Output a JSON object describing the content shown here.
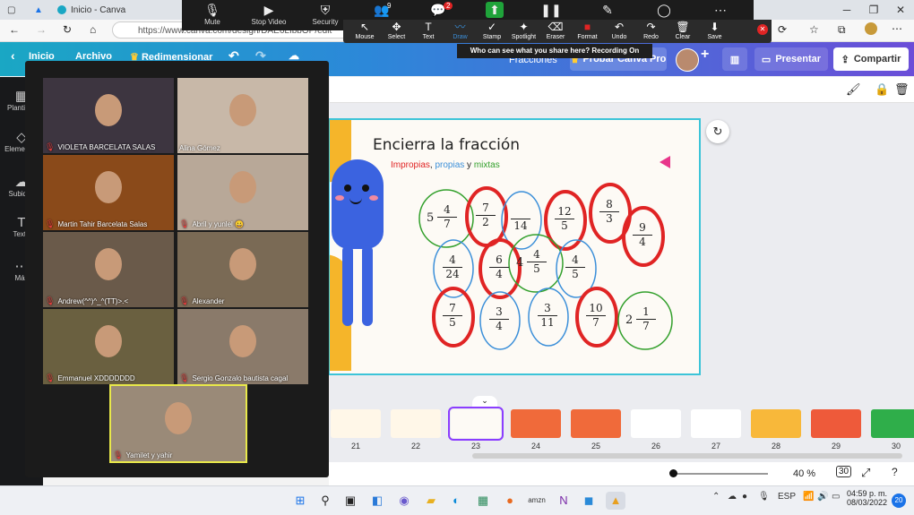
{
  "browser": {
    "tab_title": "Inicio - Canva",
    "address": "https://www.canva.com/design/DAE6LIbbOP/edit",
    "window_controls": [
      "─",
      "❐",
      "✕"
    ]
  },
  "zoom_toolbar": {
    "buttons": [
      {
        "label": "Mute",
        "icon": "mic-icon"
      },
      {
        "label": "Stop Video",
        "icon": "video-icon"
      },
      {
        "label": "Security",
        "icon": "shield-icon"
      },
      {
        "label": "",
        "icon": "participants-icon",
        "badge": "9"
      },
      {
        "label": "",
        "icon": "chat-icon",
        "badge": "2"
      },
      {
        "label": "",
        "icon": "share-icon"
      },
      {
        "label": "",
        "icon": "pause-icon"
      },
      {
        "label": "",
        "icon": "annotate-icon"
      },
      {
        "label": "",
        "icon": "remote-icon"
      },
      {
        "label": "",
        "icon": "more-icon"
      }
    ],
    "annotate": [
      "Mouse",
      "Select",
      "Text",
      "Draw",
      "Stamp",
      "Spotlight",
      "Eraser",
      "Format",
      "Undo",
      "Redo",
      "Clear",
      "Save"
    ],
    "recording_text": "Who can see what you share here? Recording On"
  },
  "canva": {
    "nav": [
      "Inicio",
      "Archivo",
      "Redimensionar"
    ],
    "design_title": "Fracciones",
    "try_pro": "Probar Canva Pro",
    "present": "Presentar",
    "share": "Compartir",
    "side": [
      "Plantillas",
      "Elementos",
      "Subidos",
      "Texto",
      "Más"
    ],
    "zoom_level": "40 %",
    "page_count": "30"
  },
  "slide": {
    "title": "Encierra la fracción",
    "subtitle_parts": [
      "Impropias",
      ", ",
      "propias",
      " y ",
      "mixtas"
    ],
    "colors": {
      "improper": "#e02424",
      "proper": "#3b8fd9",
      "mixed": "#33a02c"
    },
    "fractions": [
      {
        "whole": "5",
        "n": "4",
        "d": "7",
        "circle": "green"
      },
      {
        "whole": "",
        "n": "7",
        "d": "2",
        "circle": "red"
      },
      {
        "whole": "",
        "n": "",
        "d": "14",
        "circle": "blue"
      },
      {
        "whole": "",
        "n": "12",
        "d": "5",
        "circle": "red"
      },
      {
        "whole": "",
        "n": "8",
        "d": "3",
        "circle": "red"
      },
      {
        "whole": "",
        "n": "9",
        "d": "4",
        "circle": "red"
      },
      {
        "whole": "",
        "n": "4",
        "d": "24",
        "circle": "blue"
      },
      {
        "whole": "",
        "n": "6",
        "d": "4",
        "circle": "red"
      },
      {
        "whole": "4",
        "n": "4",
        "d": "5",
        "circle": "green"
      },
      {
        "whole": "",
        "n": "4",
        "d": "5",
        "circle": "blue"
      },
      {
        "whole": "",
        "n": "7",
        "d": "5",
        "circle": "red"
      },
      {
        "whole": "",
        "n": "3",
        "d": "4",
        "circle": "blue"
      },
      {
        "whole": "",
        "n": "3",
        "d": "11",
        "circle": "blue"
      },
      {
        "whole": "",
        "n": "10",
        "d": "7",
        "circle": "red"
      },
      {
        "whole": "2",
        "n": "1",
        "d": "7",
        "circle": "green"
      }
    ]
  },
  "filmstrip": {
    "pages": [
      "21",
      "22",
      "23",
      "24",
      "25",
      "26",
      "27",
      "28",
      "29",
      "30"
    ],
    "thumb_colors": [
      "#fff7e8",
      "#fff7e8",
      "#fdfaf5",
      "#f06a3a",
      "#f06a3a",
      "#fff",
      "#fff",
      "#f8b83a",
      "#ee5a3a",
      "#2fae4a"
    ],
    "active": "23"
  },
  "participants": [
    {
      "name": "VIOLETA  BARCELATA SALAS",
      "muted": true,
      "bg": "#3d3540"
    },
    {
      "name": "Alina Gómez",
      "muted": false,
      "bg": "#c8b8a8"
    },
    {
      "name": "Martin Tahir Barcelata Salas",
      "muted": true,
      "bg": "#8a4a1a"
    },
    {
      "name": "Abril y yunlel 😀",
      "muted": true,
      "bg": "#b8a898"
    },
    {
      "name": "Andrew(^^)^_^(TT)>.<",
      "muted": true,
      "bg": "#6a5a4a"
    },
    {
      "name": "Alexander",
      "muted": true,
      "bg": "#7a6a55"
    },
    {
      "name": "Emmanuel XDDDDDDD",
      "muted": true,
      "bg": "#6a6040"
    },
    {
      "name": "Sergio Gonzalo bautista cagal",
      "muted": true,
      "bg": "#8a7a6a"
    },
    {
      "name": "Yamilet y yahir",
      "muted": true,
      "bg": "#9a8a78"
    }
  ],
  "taskbar": {
    "lang": "ESP",
    "time": "04:59 p. m.",
    "date": "08/03/2022",
    "notif": "20"
  }
}
